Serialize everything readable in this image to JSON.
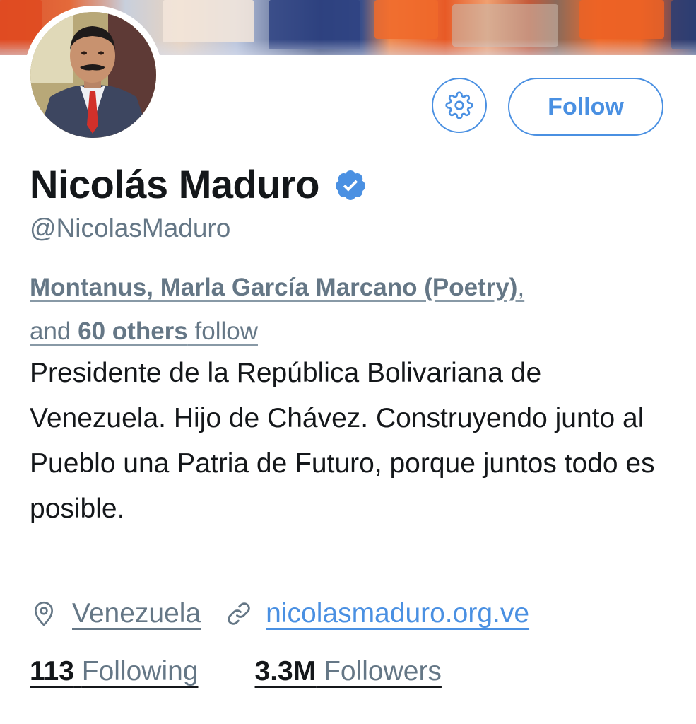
{
  "profile": {
    "name": "Nicolás Maduro",
    "handle": "@NicolasMaduro",
    "verified": true,
    "followed_by": {
      "names": "Montanus, Marla García Marcano (Poetry)",
      "comma": ",",
      "and_text": "and",
      "others_count_text": "60 others",
      "follow_text": "follow"
    },
    "bio": "Presidente de la República Bolivariana de Venezuela. Hijo de Chávez. Construyendo junto al Pueblo una Patria de Futuro, porque juntos todo es posible.",
    "location": "Venezuela",
    "website": "nicolasmaduro.org.ve",
    "stats": {
      "following_count": "113",
      "following_label": "Following",
      "followers_count": "3.3M",
      "followers_label": "Followers"
    }
  },
  "actions": {
    "follow_label": "Follow",
    "settings_icon": "gear-icon"
  },
  "icons": {
    "verified": "verified-badge-icon",
    "location": "location-pin-icon",
    "link": "link-icon"
  },
  "colors": {
    "accent": "#4a90e2",
    "text_primary": "#14171a",
    "text_secondary": "#657786",
    "verified": "#4a90e2"
  }
}
